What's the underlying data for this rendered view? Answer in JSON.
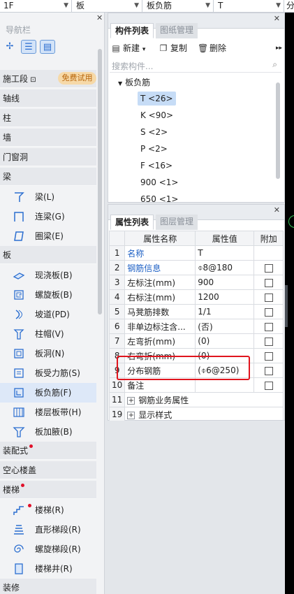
{
  "topbar": {
    "floor": "1F",
    "category": "板",
    "component_type": "板负筋",
    "component": "T",
    "right_cut": "分"
  },
  "nav": {
    "title": "导航栏",
    "items": [
      {
        "type": "cat",
        "label": "施工段",
        "lock": true,
        "badge": "免费试用"
      },
      {
        "type": "cat",
        "label": "轴线"
      },
      {
        "type": "cat",
        "label": "柱"
      },
      {
        "type": "cat",
        "label": "墙"
      },
      {
        "type": "cat",
        "label": "门窗洞"
      },
      {
        "type": "cat",
        "label": "梁"
      },
      {
        "type": "item",
        "label": "梁(L)",
        "icon": "beam-icon"
      },
      {
        "type": "item",
        "label": "连梁(G)",
        "icon": "coupling-beam-icon"
      },
      {
        "type": "item",
        "label": "圈梁(E)",
        "icon": "ring-beam-icon"
      },
      {
        "type": "cat",
        "label": "板"
      },
      {
        "type": "item",
        "label": "现浇板(B)",
        "icon": "cast-slab-icon"
      },
      {
        "type": "item",
        "label": "螺旋板(B)",
        "icon": "spiral-slab-icon"
      },
      {
        "type": "item",
        "label": "坡道(PD)",
        "icon": "ramp-icon"
      },
      {
        "type": "item",
        "label": "柱帽(V)",
        "icon": "column-cap-icon"
      },
      {
        "type": "item",
        "label": "板洞(N)",
        "icon": "slab-hole-icon"
      },
      {
        "type": "item",
        "label": "板受力筋(S)",
        "icon": "slab-main-rebar-icon"
      },
      {
        "type": "item",
        "label": "板负筋(F)",
        "icon": "slab-negative-rebar-icon",
        "active": true
      },
      {
        "type": "item",
        "label": "楼层板带(H)",
        "icon": "floor-strip-icon"
      },
      {
        "type": "item",
        "label": "板加腋(B)",
        "icon": "slab-haunch-icon"
      },
      {
        "type": "cat",
        "label": "装配式",
        "dot": true
      },
      {
        "type": "cat",
        "label": "空心楼盖"
      },
      {
        "type": "cat",
        "label": "楼梯",
        "dot": true
      },
      {
        "type": "item",
        "label": "楼梯(R)",
        "icon": "stair-icon",
        "dot": true
      },
      {
        "type": "item",
        "label": "直形梯段(R)",
        "icon": "straight-flight-icon"
      },
      {
        "type": "item",
        "label": "螺旋梯段(R)",
        "icon": "spiral-flight-icon"
      },
      {
        "type": "item",
        "label": "楼梯井(R)",
        "icon": "stair-well-icon"
      },
      {
        "type": "cat",
        "label": "装修"
      }
    ]
  },
  "component_list": {
    "tab_active": "构件列表",
    "tab_inactive": "图纸管理",
    "new_label": "新建",
    "copy_label": "复制",
    "delete_label": "删除",
    "search_placeholder": "搜索构件...",
    "tree_root": "板负筋",
    "nodes": [
      "T <26>",
      "K <90>",
      "S <2>",
      "P <2>",
      "F <16>",
      "900 <1>",
      "650 <1>"
    ]
  },
  "properties": {
    "tab_active": "属性列表",
    "tab_inactive": "图层管理",
    "col_name": "属性名称",
    "col_value": "属性值",
    "col_extra": "附加",
    "rows": [
      {
        "n": "1",
        "name": "名称",
        "value": "T",
        "blue": true,
        "check": false
      },
      {
        "n": "2",
        "name": "钢筋信息",
        "value": "⌽8@180",
        "blue": true,
        "check": true
      },
      {
        "n": "3",
        "name": "左标注(mm)",
        "value": "900",
        "check": true
      },
      {
        "n": "4",
        "name": "右标注(mm)",
        "value": "1200",
        "check": true
      },
      {
        "n": "5",
        "name": "马凳筋排数",
        "value": "1/1",
        "check": true
      },
      {
        "n": "6",
        "name": "非单边标注含...",
        "value": "(否)",
        "check": true
      },
      {
        "n": "7",
        "name": "左弯折(mm)",
        "value": "(0)",
        "check": true
      },
      {
        "n": "8",
        "name": "右弯折(mm)",
        "value": "(0)",
        "check": true
      },
      {
        "n": "9",
        "name": "分布钢筋",
        "value": "(⌽6@250)",
        "check": true
      },
      {
        "n": "10",
        "name": "备注",
        "value": "",
        "check": true
      },
      {
        "n": "11",
        "name": "钢筋业务属性",
        "value": "",
        "expand": true
      },
      {
        "n": "19",
        "name": "显示样式",
        "value": "",
        "expand": true
      }
    ]
  }
}
